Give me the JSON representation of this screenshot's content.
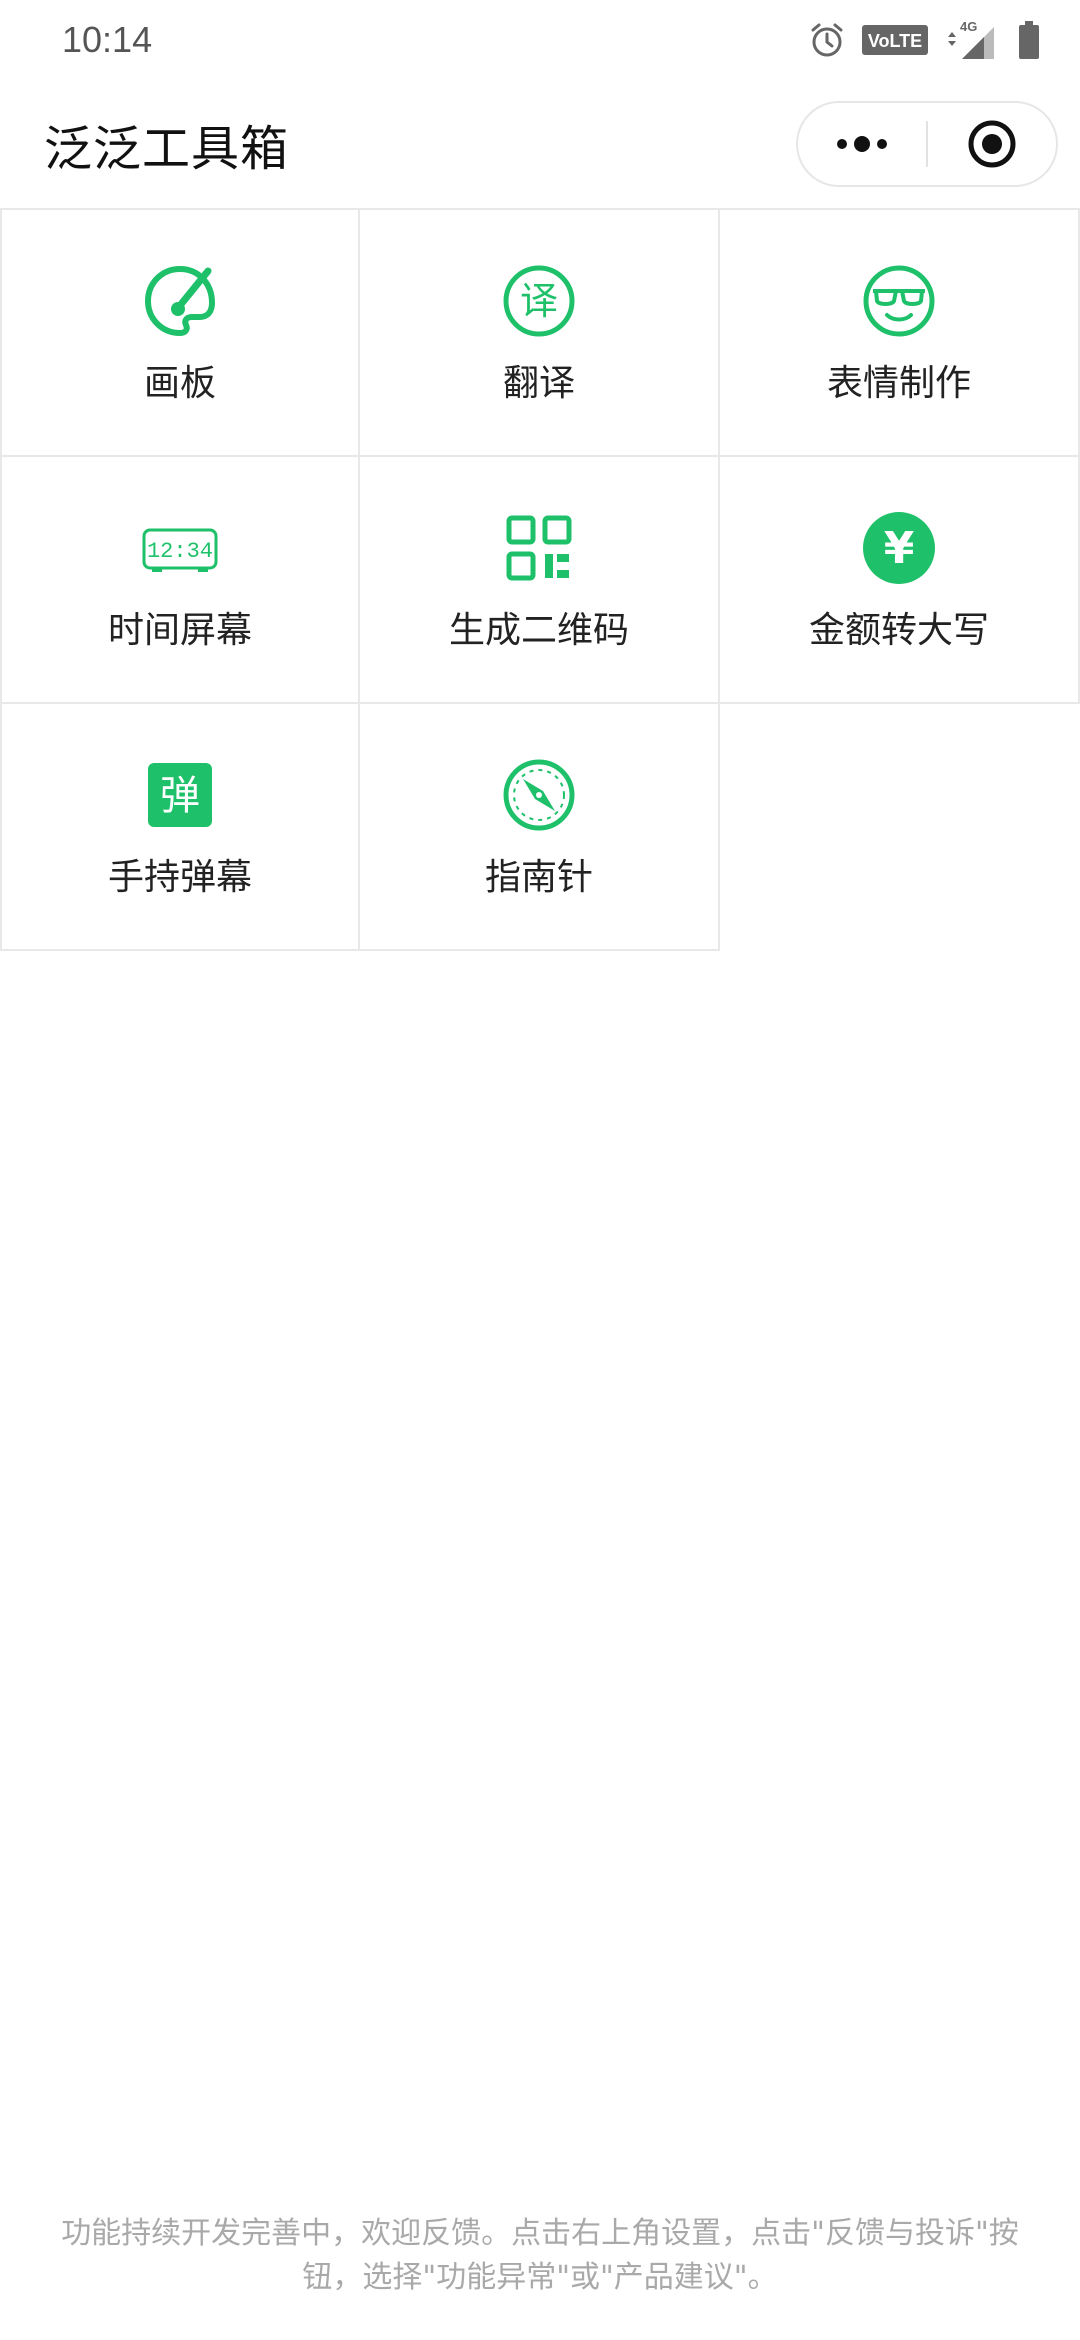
{
  "status_bar": {
    "time": "10:14",
    "network_badge": "VoLTE",
    "network_type": "4G"
  },
  "header": {
    "title": "泛泛工具箱"
  },
  "accent_color": "#1ec16a",
  "tools": [
    {
      "label": "画板",
      "icon": "palette-icon"
    },
    {
      "label": "翻译",
      "icon": "translate-icon",
      "glyph": "译"
    },
    {
      "label": "表情制作",
      "icon": "sunglasses-face-icon"
    },
    {
      "label": "时间屏幕",
      "icon": "digital-clock-icon",
      "glyph": "12:34"
    },
    {
      "label": "生成二维码",
      "icon": "qr-code-icon"
    },
    {
      "label": "金额转大写",
      "icon": "yen-icon",
      "glyph": "¥"
    },
    {
      "label": "手持弹幕",
      "icon": "danmaku-icon",
      "glyph": "弹"
    },
    {
      "label": "指南针",
      "icon": "compass-icon"
    }
  ],
  "footer": {
    "note": "功能持续开发完善中，欢迎反馈。点击右上角设置，点击\"反馈与投诉\"按钮，选择\"功能异常\"或\"产品建议\"。"
  }
}
